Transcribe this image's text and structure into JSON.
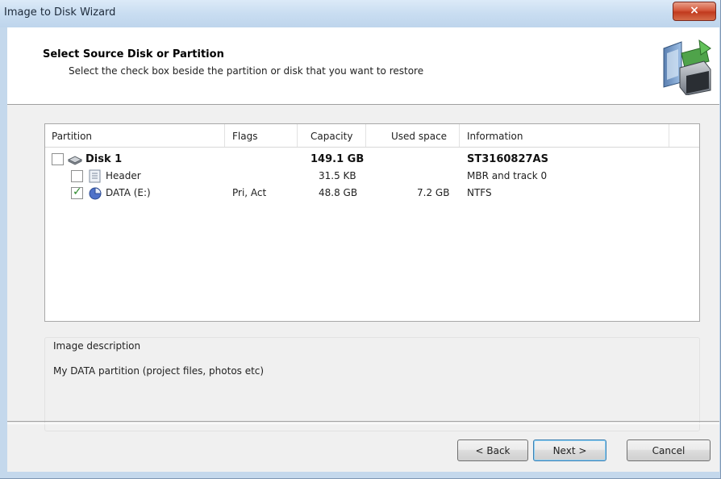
{
  "window": {
    "title": "Image to Disk Wizard",
    "close_glyph": "×"
  },
  "header": {
    "title": "Select Source Disk or Partition",
    "subtitle": "Select the check box beside the partition or disk that you want to restore",
    "graphic_icon": "disk-image-restore-icon"
  },
  "list": {
    "columns": [
      "Partition",
      "Flags",
      "Capacity",
      "Used space",
      "Information"
    ],
    "rows": [
      {
        "name": "Disk 1",
        "flags": "",
        "capacity": "149.1 GB",
        "used": "",
        "info": "ST3160827AS",
        "checked": false,
        "icon": "hard-disk-icon"
      },
      {
        "name": "Header",
        "flags": "",
        "capacity": "31.5 KB",
        "used": "",
        "info": "MBR and track 0",
        "checked": false,
        "icon": "header-icon"
      },
      {
        "name": "DATA (E:)",
        "flags": "Pri, Act",
        "capacity": "48.8 GB",
        "used": "7.2 GB",
        "info": "NTFS",
        "checked": true,
        "icon": "partition-icon"
      }
    ]
  },
  "description": {
    "label": "Image description",
    "text": "My DATA partition (project files, photos etc)"
  },
  "buttons": {
    "back": "< Back",
    "next": "Next >",
    "cancel": "Cancel"
  },
  "colors": {
    "check_green": "#2d8a2d",
    "close_red": "#c13a1e",
    "accent_blue": "#3c7fb1"
  }
}
